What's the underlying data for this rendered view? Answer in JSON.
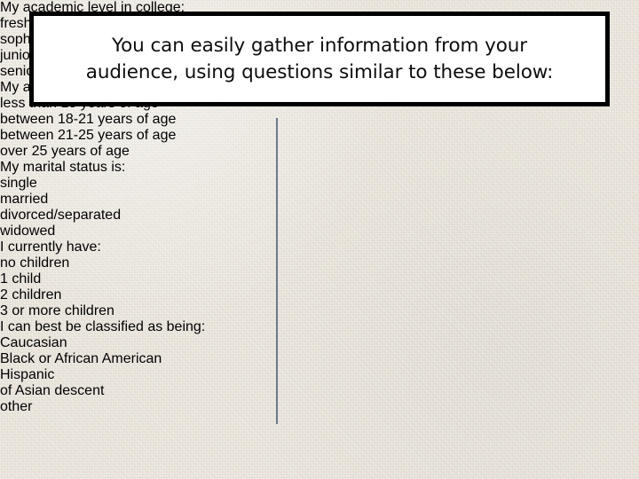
{
  "slide": {
    "background_color": "#e9e4da",
    "title_box": {
      "background_color": "#ffffff",
      "border_color": "#000000",
      "title": "You can easily gather information from your\naudience, using questions similar to these below:"
    },
    "divider": {
      "color": "#6b7a8f"
    },
    "left_column": {
      "lines": [
        "My academic level in college:",
        "freshman",
        "sophomore",
        "junior",
        "senior",
        "My age is:",
        "less than 18 years of age",
        "between 18-21 years of age",
        "between 21-25 years of age",
        "over 25 years of age",
        "My marital status is:",
        "single",
        "married",
        "divorced/separated",
        "widowed"
      ]
    },
    "right_column": {
      "lines": [
        "I currently have:",
        "no children",
        "1 child",
        "2 children",
        "3 or more children",
        "I can best be classified as being:",
        "Caucasian",
        "Black or African American",
        "Hispanic",
        "of Asian descent",
        "other"
      ]
    }
  }
}
